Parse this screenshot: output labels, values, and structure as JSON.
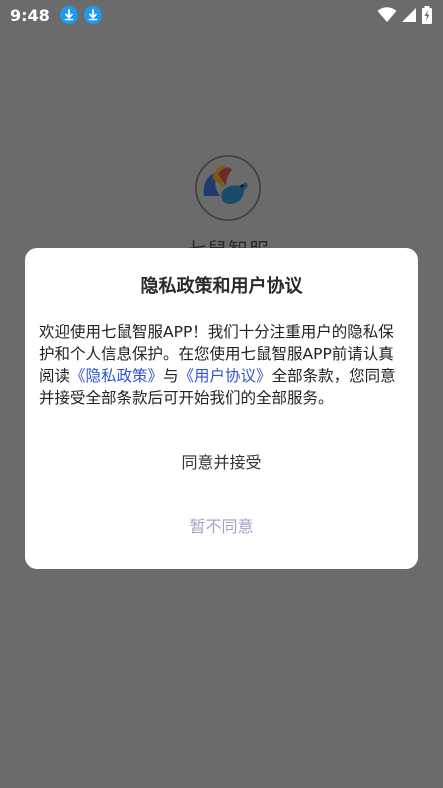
{
  "status_bar": {
    "time": "9:48",
    "icons": [
      "download-icon",
      "download-icon",
      "wifi-icon",
      "signal-icon",
      "battery-icon"
    ]
  },
  "splash": {
    "app_name": "七鼠智服"
  },
  "dialog": {
    "title": "隐私政策和用户协议",
    "body": {
      "part1": "欢迎使用七鼠智服APP！我们十分注重用户的隐私保护和个人信息保护。在您使用七鼠智服APP前请认真阅读",
      "privacy_link": "《隐私政策》",
      "part2": "与",
      "agreement_link": "《用户协议》",
      "part3": "全部条款，您同意并接受全部条款后可开始我们的全部服务。"
    },
    "agree_label": "同意并接受",
    "decline_label": "暂不同意"
  },
  "colors": {
    "overlay": "#6b6b6b",
    "link": "#2f55d4",
    "decline": "#a99fc6",
    "download_badge": "#1e9bf0"
  }
}
